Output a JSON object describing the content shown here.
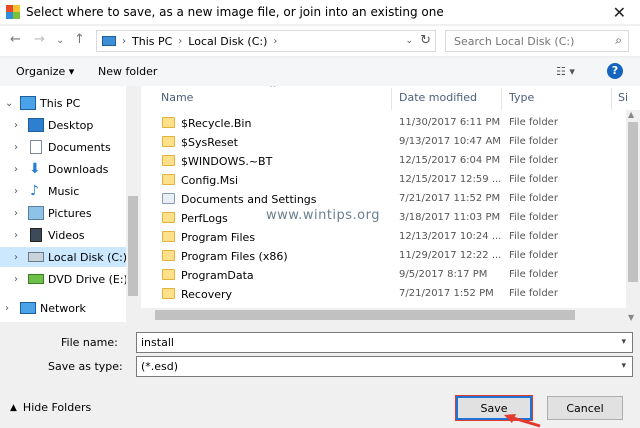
{
  "window": {
    "title": "Select where to save, as a new image file, or join into an existing one"
  },
  "address": {
    "parts": [
      "This PC",
      "Local Disk (C:)"
    ]
  },
  "search": {
    "placeholder": "Search Local Disk (C:)"
  },
  "toolbar": {
    "organize": "Organize",
    "new_folder": "New folder"
  },
  "nav": {
    "items": [
      {
        "label": "This PC",
        "icon": "computer-icon"
      },
      {
        "label": "Desktop",
        "icon": "desktop-icon"
      },
      {
        "label": "Documents",
        "icon": "documents-icon"
      },
      {
        "label": "Downloads",
        "icon": "downloads-icon"
      },
      {
        "label": "Music",
        "icon": "music-icon"
      },
      {
        "label": "Pictures",
        "icon": "pictures-icon"
      },
      {
        "label": "Videos",
        "icon": "videos-icon"
      },
      {
        "label": "Local Disk (C:)",
        "icon": "drive-icon",
        "selected": true
      },
      {
        "label": "DVD Drive (E:) C(",
        "icon": "dvd-icon"
      },
      {
        "label": "Network",
        "icon": "network-icon"
      }
    ]
  },
  "columns": {
    "name": "Name",
    "date": "Date modified",
    "type": "Type",
    "size": "Si"
  },
  "files": [
    {
      "name": "$Recycle.Bin",
      "date": "11/30/2017 6:11 PM",
      "type": "File folder"
    },
    {
      "name": "$SysReset",
      "date": "9/13/2017 10:47 AM",
      "type": "File folder"
    },
    {
      "name": "$WINDOWS.~BT",
      "date": "12/15/2017 6:04 PM",
      "type": "File folder"
    },
    {
      "name": "Config.Msi",
      "date": "12/15/2017 12:59 ...",
      "type": "File folder"
    },
    {
      "name": "Documents and Settings",
      "date": "7/21/2017 11:52 PM",
      "type": "File folder"
    },
    {
      "name": "PerfLogs",
      "date": "3/18/2017 11:03 PM",
      "type": "File folder"
    },
    {
      "name": "Program Files",
      "date": "12/13/2017 10:24 ...",
      "type": "File folder"
    },
    {
      "name": "Program Files (x86)",
      "date": "11/29/2017 12:22 ...",
      "type": "File folder"
    },
    {
      "name": "ProgramData",
      "date": "9/5/2017 8:17 PM",
      "type": "File folder"
    },
    {
      "name": "Recovery",
      "date": "7/21/2017 1:52 PM",
      "type": "File folder"
    }
  ],
  "watermark": "www.wintips.org",
  "form": {
    "file_name_label": "File name:",
    "file_name_value": "install",
    "save_type_label": "Save as type:",
    "save_type_value": "(*.esd)"
  },
  "footer": {
    "hide_folders": "Hide Folders",
    "save": "Save",
    "cancel": "Cancel"
  },
  "colors": {
    "accent": "#1e74d6",
    "selection": "#cce8ff",
    "folder": "#ffe08a",
    "annotation_arrow": "#e23b2e"
  }
}
